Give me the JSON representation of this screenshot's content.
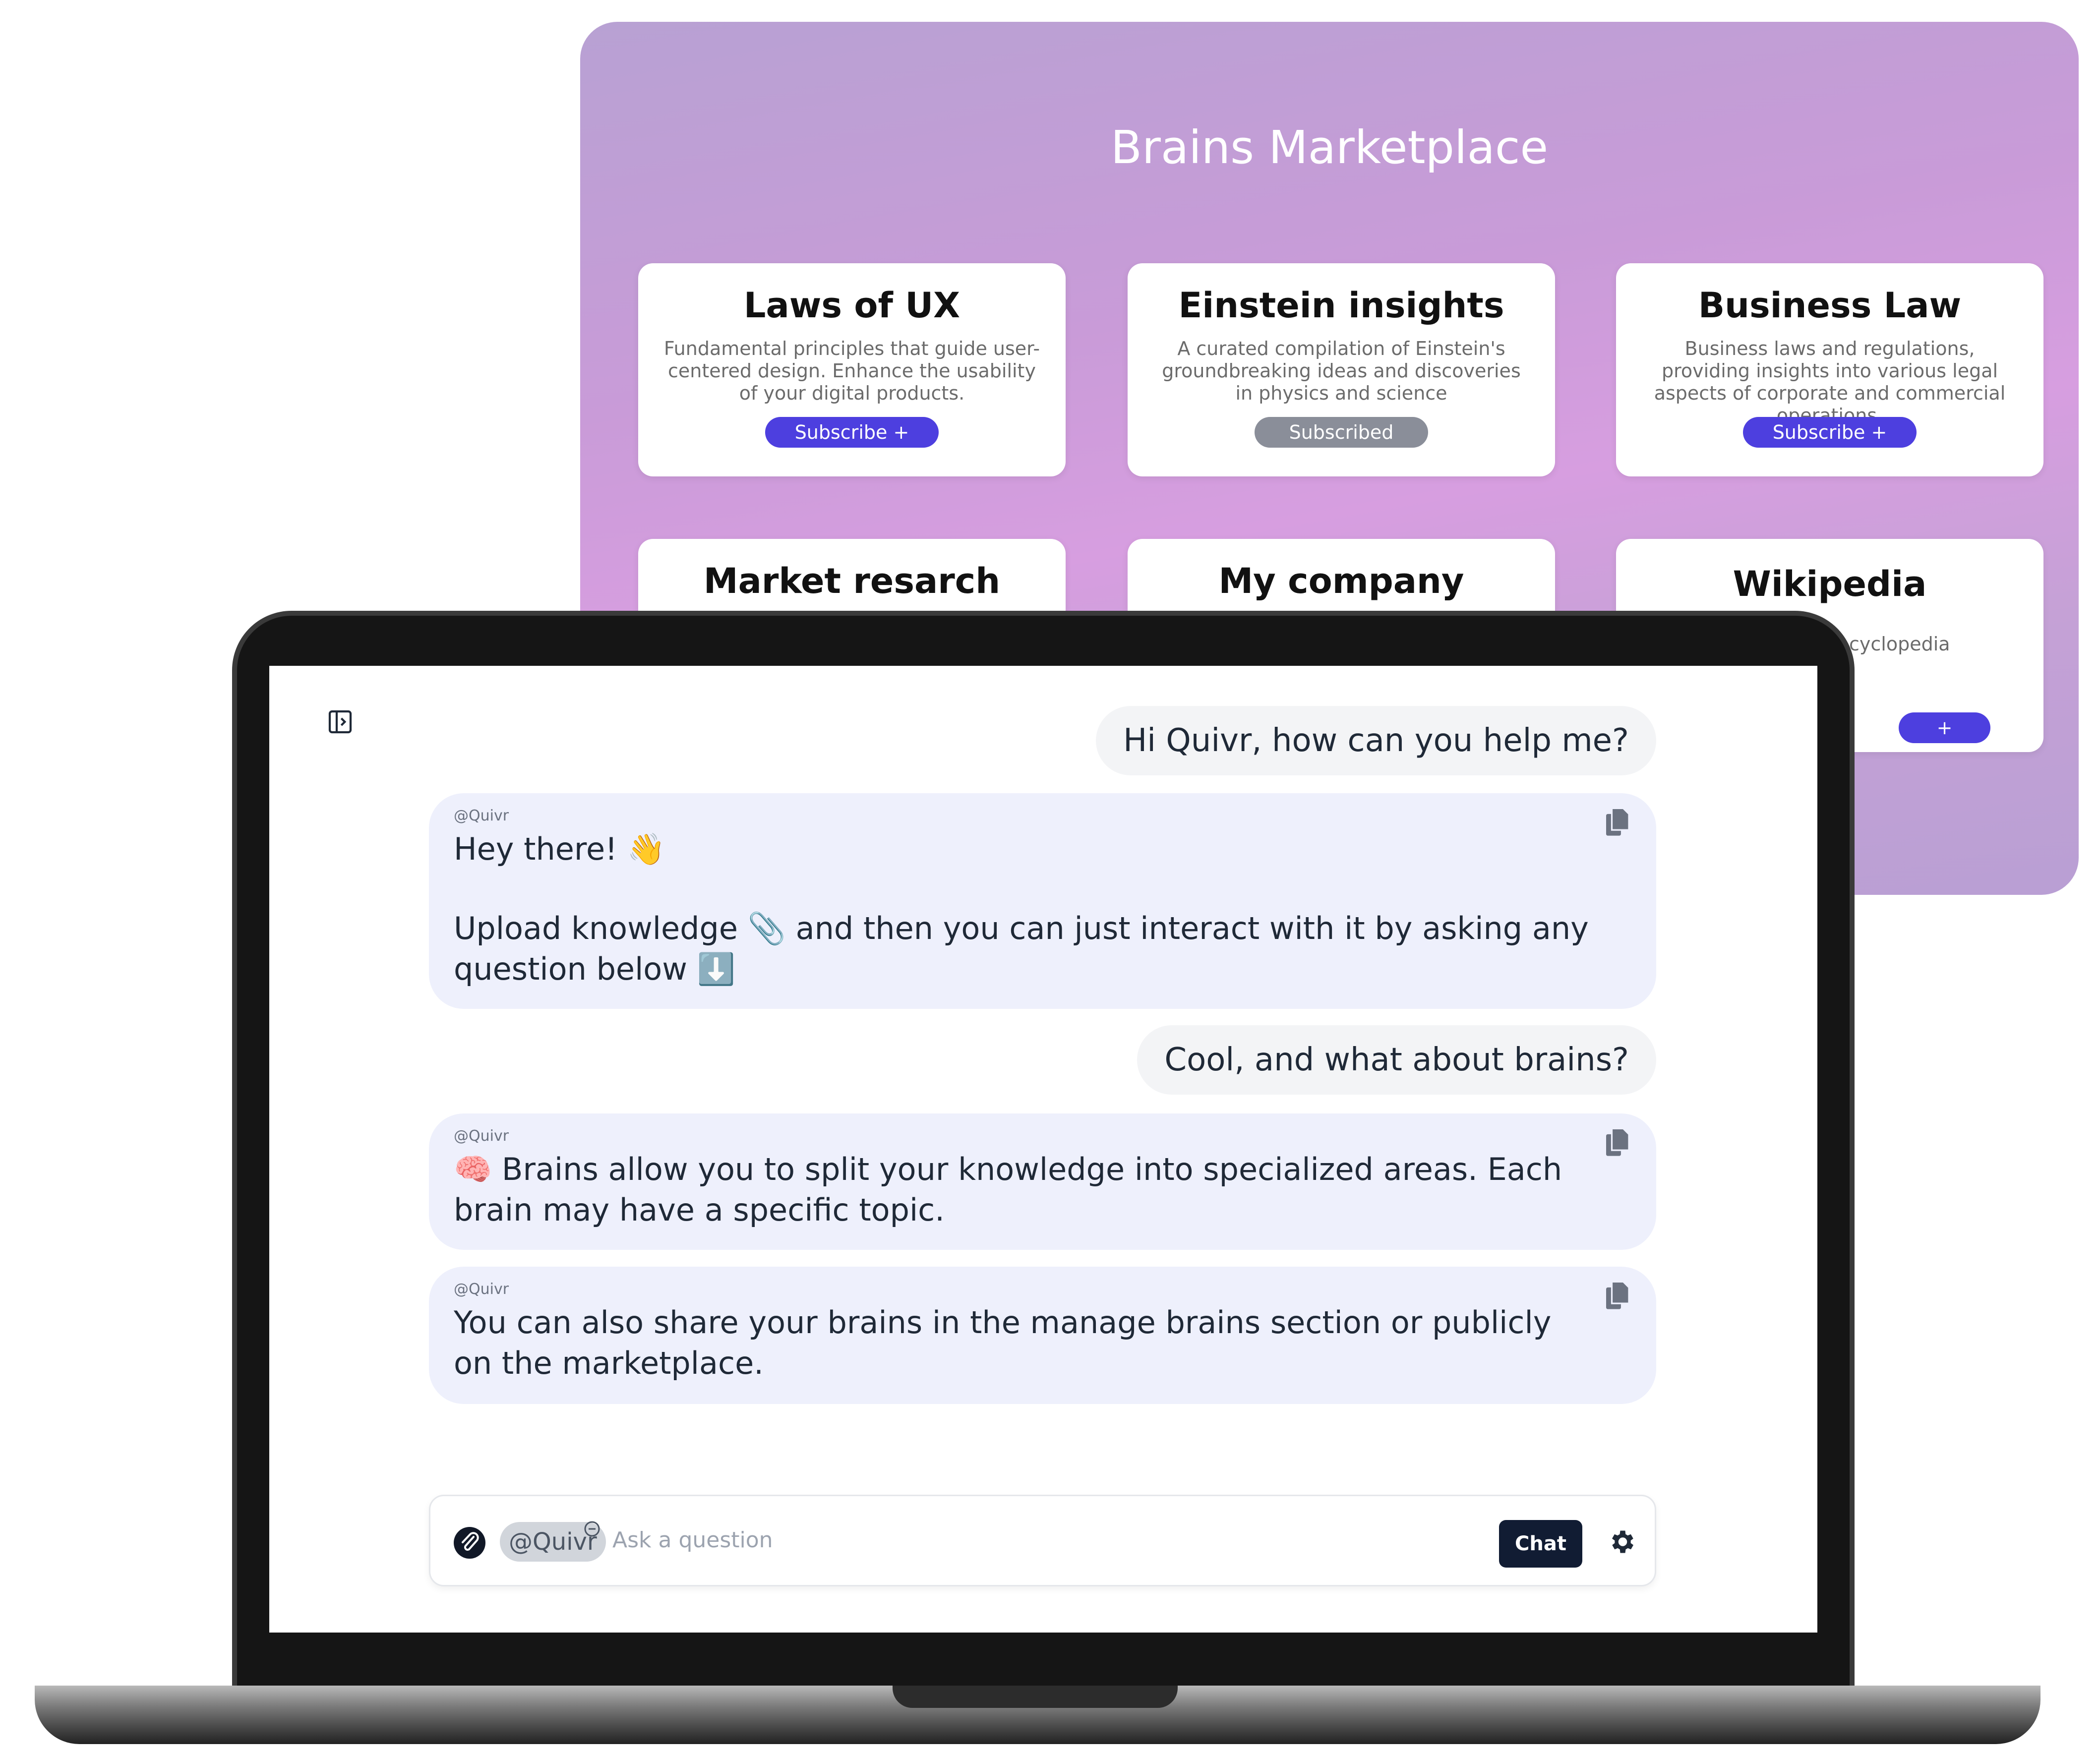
{
  "marketplace": {
    "title": "Brains Marketplace",
    "cards": [
      {
        "title": "Laws of UX",
        "description": "Fundamental principles that guide user-centered design. Enhance the usability of your digital products.",
        "button": "Subscribe +"
      },
      {
        "title": "Einstein insights",
        "description": "A curated compilation of Einstein's groundbreaking ideas and discoveries in physics and science",
        "button": "Subscribed"
      },
      {
        "title": "Business Law",
        "description": "Business laws and regulations, providing insights into various legal aspects of corporate and commercial operations.",
        "button": "Subscribe +"
      },
      {
        "title": "Market resarch",
        "description": "",
        "button": ""
      },
      {
        "title": "My company",
        "description": "",
        "button": ""
      },
      {
        "title": "Wikipedia",
        "description": "cyclopedia",
        "button": "+"
      }
    ],
    "colors": {
      "subscribe": "#4d3fdf",
      "subscribed": "#8a8e99"
    }
  },
  "chat": {
    "messages": [
      {
        "role": "user",
        "text": "Hi Quivr, how can you help me?"
      },
      {
        "role": "assistant",
        "author": "@Quivr",
        "lines": [
          "Hey there! 👋",
          "",
          "Upload knowledge 📎 and then you can just interact with it by asking any question below ⬇️"
        ]
      },
      {
        "role": "user",
        "text": "Cool, and what about brains?"
      },
      {
        "role": "assistant",
        "author": "@Quivr",
        "lines": [
          "🧠 Brains allow you to split your knowledge into specialized areas. Each brain may have a specific topic."
        ]
      },
      {
        "role": "assistant",
        "author": "@Quivr",
        "lines": [
          "You can also share your brains in the manage brains section or publicly on the marketplace."
        ]
      }
    ],
    "input": {
      "mention": "@Quivr",
      "placeholder": "Ask a question",
      "value": "",
      "send_label": "Chat"
    },
    "icons": {
      "sidebar": "sidebar-toggle-icon",
      "copy": "copy-icon",
      "attach": "paperclip-icon",
      "remove": "remove-mention-icon",
      "settings": "gear-icon"
    }
  }
}
